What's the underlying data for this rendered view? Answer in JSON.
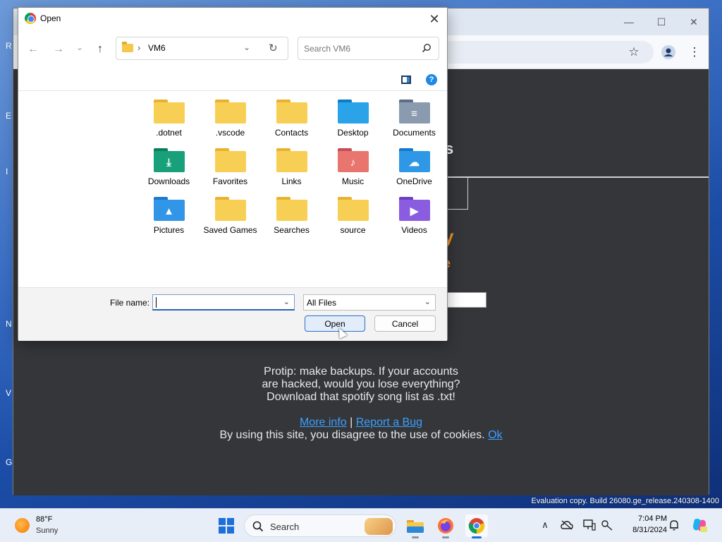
{
  "dialog": {
    "title": "Open",
    "close_glyph": "✕",
    "nav": {
      "back_glyph": "←",
      "forward_glyph": "→",
      "recent_glyph": "⌄",
      "up_glyph": "↑"
    },
    "address": {
      "separator": "›",
      "location": "VM6",
      "chevron": "⌄",
      "refresh_glyph": "↻"
    },
    "search_placeholder": "Search VM6",
    "help_glyph": "?",
    "items": [
      {
        "label": ".dotnet",
        "kind": "plain"
      },
      {
        "label": ".vscode",
        "kind": "plain"
      },
      {
        "label": "Contacts",
        "kind": "plain"
      },
      {
        "label": "Desktop",
        "kind": "desktop"
      },
      {
        "label": "Documents",
        "kind": "documents"
      },
      {
        "label": "Downloads",
        "kind": "downloads"
      },
      {
        "label": "Favorites",
        "kind": "plain"
      },
      {
        "label": "Links",
        "kind": "plain"
      },
      {
        "label": "Music",
        "kind": "music"
      },
      {
        "label": "OneDrive",
        "kind": "onedrive"
      },
      {
        "label": "Pictures",
        "kind": "pictures"
      },
      {
        "label": "Saved Games",
        "kind": "plain"
      },
      {
        "label": "Searches",
        "kind": "plain"
      },
      {
        "label": "source",
        "kind": "plain"
      },
      {
        "label": "Videos",
        "kind": "videos"
      }
    ],
    "footer": {
      "file_name_label": "File name:",
      "file_name_value": "",
      "file_type": "All Files",
      "open_label": "Open",
      "cancel_label": "Cancel"
    }
  },
  "page": {
    "protip_lines": [
      "Protip: make backups. If your accounts",
      "are hacked, would you lose everything?",
      "Download that spotify song list as .txt!"
    ],
    "more_info": "More info",
    "separator": "|",
    "report_bug": "Report a Bug",
    "cookie_text": "By using this site, you disagree to the use of cookies.",
    "ok_link": "Ok",
    "partial_heading": "s",
    "partial_orange_1": "y",
    "partial_orange_2": "e"
  },
  "browser": {
    "minimize": "—",
    "maximize": "☐",
    "close": "✕",
    "bookmark_glyph": "☆",
    "menu_glyph": "⋮"
  },
  "desktop": {
    "left_letters": [
      "R",
      "E",
      "I",
      "N",
      "V",
      "G"
    ],
    "watermark": "Evaluation copy. Build 26080.ge_release.240308-1400"
  },
  "taskbar": {
    "weather_temp": "88°F",
    "weather_condition": "Sunny",
    "search_label": "Search",
    "time": "7:04 PM",
    "date": "8/31/2024"
  },
  "colors": {
    "accent": "#1e6fd9",
    "page_bg": "#35363a",
    "link": "#3aa0ff",
    "orange": "#f0932b"
  }
}
